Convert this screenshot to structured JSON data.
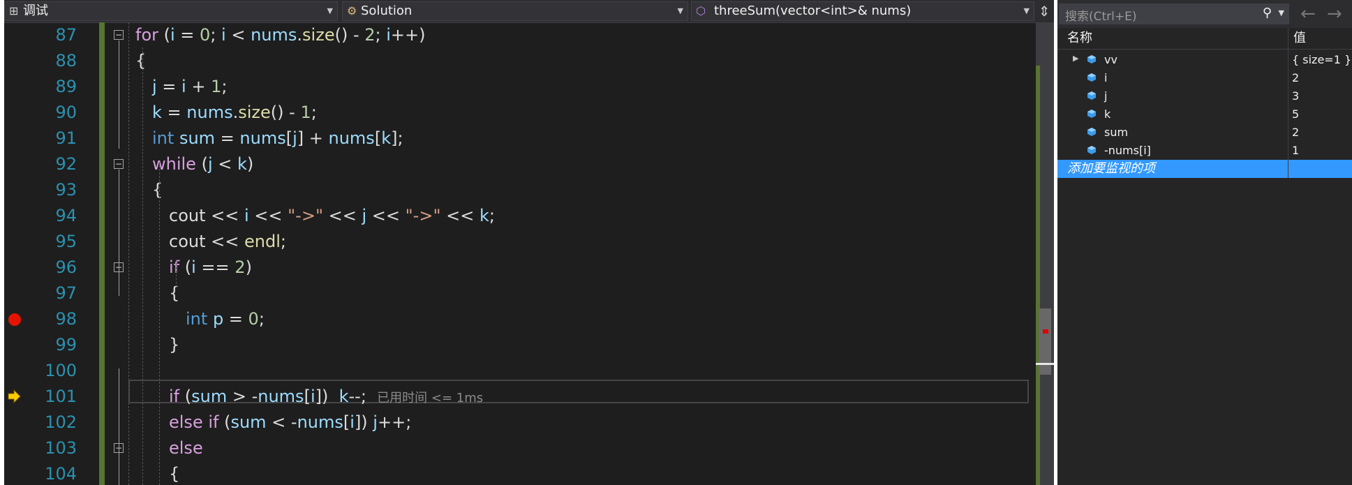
{
  "navbar": {
    "scope_label": "调试",
    "class_label": "Solution",
    "member_label": "threeSum(vector<int>& nums)"
  },
  "code_lines": [
    {
      "num": "87",
      "tokens": [
        [
          "ctl",
          "for"
        ],
        [
          "txt",
          " ("
        ],
        [
          "var",
          "i"
        ],
        [
          "txt",
          " = "
        ],
        [
          "num",
          "0"
        ],
        [
          "txt",
          "; "
        ],
        [
          "var",
          "i"
        ],
        [
          "txt",
          " < "
        ],
        [
          "var",
          "nums"
        ],
        [
          "txt",
          "."
        ],
        [
          "fn",
          "size"
        ],
        [
          "txt",
          "() - "
        ],
        [
          "num",
          "2"
        ],
        [
          "txt",
          "; "
        ],
        [
          "var",
          "i"
        ],
        [
          "txt",
          "++)"
        ]
      ]
    },
    {
      "num": "88",
      "tokens": [
        [
          "txt",
          "{"
        ]
      ]
    },
    {
      "num": "89",
      "tokens": [
        [
          "var",
          "j"
        ],
        [
          "txt",
          " = "
        ],
        [
          "var",
          "i"
        ],
        [
          "txt",
          " + "
        ],
        [
          "num",
          "1"
        ],
        [
          "txt",
          ";"
        ]
      ]
    },
    {
      "num": "90",
      "tokens": [
        [
          "var",
          "k"
        ],
        [
          "txt",
          " = "
        ],
        [
          "var",
          "nums"
        ],
        [
          "txt",
          "."
        ],
        [
          "fn",
          "size"
        ],
        [
          "txt",
          "() - "
        ],
        [
          "num",
          "1"
        ],
        [
          "txt",
          ";"
        ]
      ]
    },
    {
      "num": "91",
      "tokens": [
        [
          "kw",
          "int"
        ],
        [
          "txt",
          " "
        ],
        [
          "var",
          "sum"
        ],
        [
          "txt",
          " = "
        ],
        [
          "var",
          "nums"
        ],
        [
          "txt",
          "["
        ],
        [
          "var",
          "j"
        ],
        [
          "txt",
          "] + "
        ],
        [
          "var",
          "nums"
        ],
        [
          "txt",
          "["
        ],
        [
          "var",
          "k"
        ],
        [
          "txt",
          "];"
        ]
      ]
    },
    {
      "num": "92",
      "tokens": [
        [
          "ctl",
          "while"
        ],
        [
          "txt",
          " ("
        ],
        [
          "var",
          "j"
        ],
        [
          "txt",
          " < "
        ],
        [
          "var",
          "k"
        ],
        [
          "txt",
          ")"
        ]
      ]
    },
    {
      "num": "93",
      "tokens": [
        [
          "txt",
          "{"
        ]
      ]
    },
    {
      "num": "94",
      "tokens": [
        [
          "txt",
          "cout << "
        ],
        [
          "var",
          "i"
        ],
        [
          "txt",
          " << "
        ],
        [
          "str",
          "\"->\""
        ],
        [
          "txt",
          " << "
        ],
        [
          "var",
          "j"
        ],
        [
          "txt",
          " << "
        ],
        [
          "str",
          "\"->\""
        ],
        [
          "txt",
          " << "
        ],
        [
          "var",
          "k"
        ],
        [
          "txt",
          ";"
        ]
      ]
    },
    {
      "num": "95",
      "tokens": [
        [
          "txt",
          "cout << "
        ],
        [
          "fn",
          "endl"
        ],
        [
          "txt",
          ";"
        ]
      ]
    },
    {
      "num": "96",
      "tokens": [
        [
          "ctl",
          "if"
        ],
        [
          "txt",
          " ("
        ],
        [
          "var",
          "i"
        ],
        [
          "txt",
          " == "
        ],
        [
          "num",
          "2"
        ],
        [
          "txt",
          ")"
        ]
      ]
    },
    {
      "num": "97",
      "tokens": [
        [
          "txt",
          "{"
        ]
      ]
    },
    {
      "num": "98",
      "tokens": [
        [
          "kw",
          "int"
        ],
        [
          "txt",
          " "
        ],
        [
          "var",
          "p"
        ],
        [
          "txt",
          " = "
        ],
        [
          "num",
          "0"
        ],
        [
          "txt",
          ";"
        ]
      ]
    },
    {
      "num": "99",
      "tokens": [
        [
          "txt",
          "}"
        ]
      ]
    },
    {
      "num": "100",
      "tokens": []
    },
    {
      "num": "101",
      "tokens": [
        [
          "ctl",
          "if"
        ],
        [
          "txt",
          " ("
        ],
        [
          "var",
          "sum"
        ],
        [
          "txt",
          " > -"
        ],
        [
          "var",
          "nums"
        ],
        [
          "txt",
          "["
        ],
        [
          "var",
          "i"
        ],
        [
          "txt",
          "])  "
        ],
        [
          "var",
          "k"
        ],
        [
          "txt",
          "--;  "
        ],
        [
          "perf",
          "已用时间 <= 1ms"
        ]
      ]
    },
    {
      "num": "102",
      "tokens": [
        [
          "ctl",
          "else if"
        ],
        [
          "txt",
          " ("
        ],
        [
          "var",
          "sum"
        ],
        [
          "txt",
          " < -"
        ],
        [
          "var",
          "nums"
        ],
        [
          "txt",
          "["
        ],
        [
          "var",
          "i"
        ],
        [
          "txt",
          "]) "
        ],
        [
          "var",
          "j"
        ],
        [
          "txt",
          "++;"
        ]
      ]
    },
    {
      "num": "103",
      "tokens": [
        [
          "ctl",
          "else"
        ]
      ]
    },
    {
      "num": "104",
      "tokens": [
        [
          "txt",
          "{"
        ]
      ]
    }
  ],
  "watch": {
    "search_placeholder": "搜索(Ctrl+E)",
    "col_name": "名称",
    "col_value": "值",
    "rows": [
      {
        "name": "vv",
        "value": "{ size=1 }"
      },
      {
        "name": "i",
        "value": "2"
      },
      {
        "name": "j",
        "value": "3"
      },
      {
        "name": "k",
        "value": "5"
      },
      {
        "name": "sum",
        "value": "2"
      },
      {
        "name": "-nums[i]",
        "value": "1"
      }
    ],
    "add_item": "添加要监视的项"
  },
  "colors": {
    "editor_bg": "#1e1e1e",
    "keyword": "#569cd6",
    "control": "#d8a0df",
    "variable": "#9cdcfe",
    "function": "#dcdcaa",
    "number": "#b5cea8",
    "string": "#d69d85",
    "line_number": "#2b91af",
    "breakpoint": "#e51400",
    "selection": "#3399ff"
  }
}
